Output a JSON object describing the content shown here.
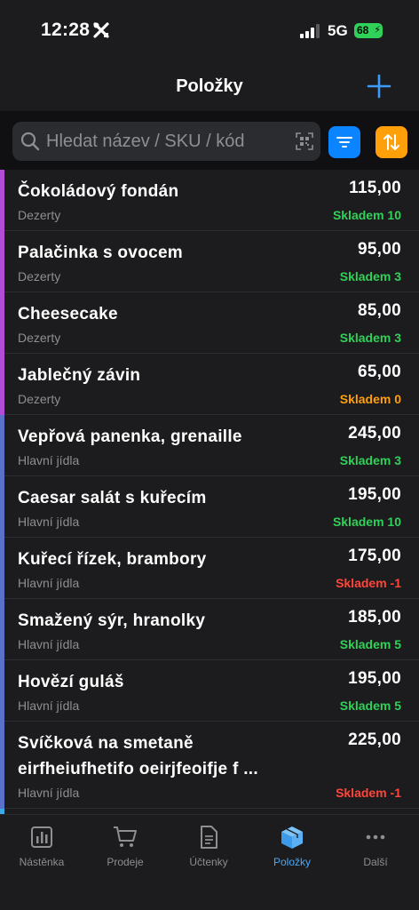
{
  "status": {
    "time": "12:28",
    "network": "5G",
    "battery": "68"
  },
  "nav": {
    "title": "Položky"
  },
  "search": {
    "placeholder": "Hledat název / SKU / kód",
    "value": ""
  },
  "colors": {
    "accent": "#0a84ff",
    "sort": "#ff9f0a",
    "stock_ok": "#30d158",
    "stock_zero": "#ff9f0a",
    "stock_negative": "#ff453a",
    "dezerty": "#b44bd6",
    "hlavni_jidla": "#5b70c9",
    "next_category": "#39a9e8"
  },
  "items": [
    {
      "name": "Čokoládový fondán",
      "price": "115,00",
      "category": "Dezerty",
      "stock": "Skladem 10",
      "stock_status": "ok"
    },
    {
      "name": "Palačinka s ovocem",
      "price": "95,00",
      "category": "Dezerty",
      "stock": "Skladem 3",
      "stock_status": "ok"
    },
    {
      "name": "Cheesecake",
      "price": "85,00",
      "category": "Dezerty",
      "stock": "Skladem 3",
      "stock_status": "ok"
    },
    {
      "name": "Jablečný závin",
      "price": "65,00",
      "category": "Dezerty",
      "stock": "Skladem 0",
      "stock_status": "zero"
    },
    {
      "name": "Vepřová panenka, grenaille",
      "price": "245,00",
      "category": "Hlavní jídla",
      "stock": "Skladem 3",
      "stock_status": "ok"
    },
    {
      "name": "Caesar salát s kuřecím",
      "price": "195,00",
      "category": "Hlavní jídla",
      "stock": "Skladem 10",
      "stock_status": "ok"
    },
    {
      "name": "Kuřecí řízek, brambory",
      "price": "175,00",
      "category": "Hlavní jídla",
      "stock": "Skladem -1",
      "stock_status": "negative"
    },
    {
      "name": "Smažený sýr, hranolky",
      "price": "185,00",
      "category": "Hlavní jídla",
      "stock": "Skladem 5",
      "stock_status": "ok"
    },
    {
      "name": "Hovězí guláš",
      "price": "195,00",
      "category": "Hlavní jídla",
      "stock": "Skladem 5",
      "stock_status": "ok"
    },
    {
      "name": "Svíčková na smetaně eirfheiufhetifo oeirjfeoifje f ...",
      "price": "225,00",
      "category": "Hlavní jídla",
      "stock": "Skladem -1",
      "stock_status": "negative"
    }
  ],
  "tabs": [
    {
      "label": "Nástěnka",
      "icon": "chart-icon"
    },
    {
      "label": "Prodeje",
      "icon": "cart-icon"
    },
    {
      "label": "Účtenky",
      "icon": "receipt-icon"
    },
    {
      "label": "Položky",
      "icon": "box-icon",
      "active": true
    },
    {
      "label": "Další",
      "icon": "more-icon"
    }
  ]
}
